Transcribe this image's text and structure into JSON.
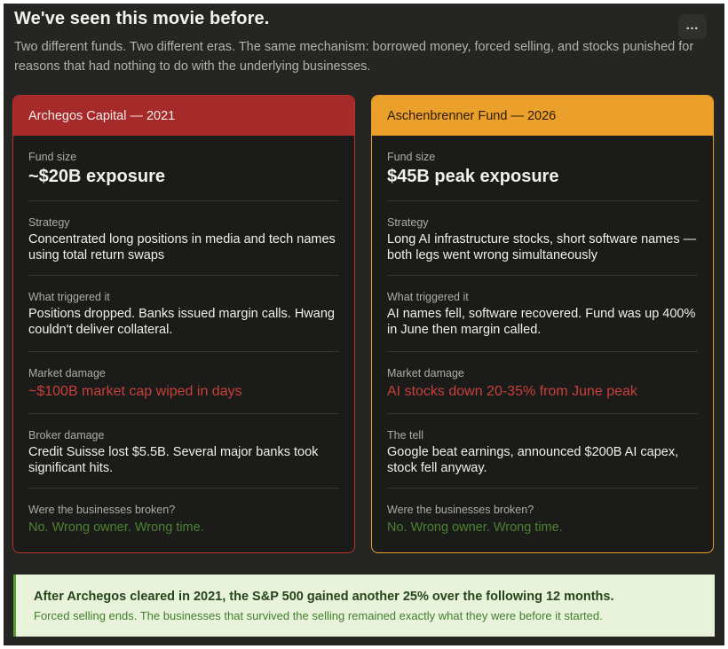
{
  "header": {
    "title": "We've seen this movie before.",
    "subtitle": "Two different funds. Two different eras. The same mechanism: borrowed money, forced selling, and stocks punished for reasons that had nothing to do with the underlying businesses.",
    "more_label": "…",
    "more_icon": "more-horizontal-icon"
  },
  "archegos": {
    "title": "Archegos Capital — 2021",
    "accent": "#a52a29",
    "rows": [
      {
        "label": "Fund size",
        "value": "~$20B exposure"
      },
      {
        "label": "Strategy",
        "value": "Concentrated long positions in media and tech names using total return swaps"
      },
      {
        "label": "What triggered it",
        "value": "Positions dropped. Banks issued margin calls. Hwang couldn't deliver collateral."
      },
      {
        "label": "Market damage",
        "value": "~$100B market cap wiped in days"
      },
      {
        "label": "Broker damage",
        "value": "Credit Suisse lost $5.5B. Several major banks took significant hits."
      },
      {
        "label": "Were the businesses broken?",
        "value": "No. Wrong owner. Wrong time."
      }
    ]
  },
  "aschenbrenner": {
    "title": "Aschenbrenner Fund — 2026",
    "accent": "#eba02c",
    "rows": [
      {
        "label": "Fund size",
        "value": "$45B peak exposure"
      },
      {
        "label": "Strategy",
        "value": "Long AI infrastructure stocks, short software names — both legs went wrong simultaneously"
      },
      {
        "label": "What triggered it",
        "value": "AI names fell, software recovered. Fund was up 400% in June then margin called."
      },
      {
        "label": "Market damage",
        "value": "AI stocks down 20-35% from June peak"
      },
      {
        "label": "The tell",
        "value": "Google beat earnings, announced $200B AI capex, stock fell anyway."
      },
      {
        "label": "Were the businesses broken?",
        "value": "No. Wrong owner. Wrong time."
      }
    ]
  },
  "banner": {
    "headline": "After Archegos cleared in 2021, the S&P 500 gained another 25% over the following 12 months.",
    "note": "Forced selling ends. The businesses that survived the selling remained exactly what they were before it started."
  },
  "colors": {
    "damage_red": "#c8403b",
    "verdict_green": "#4b8430",
    "banner_bg": "#e9f3dc"
  }
}
